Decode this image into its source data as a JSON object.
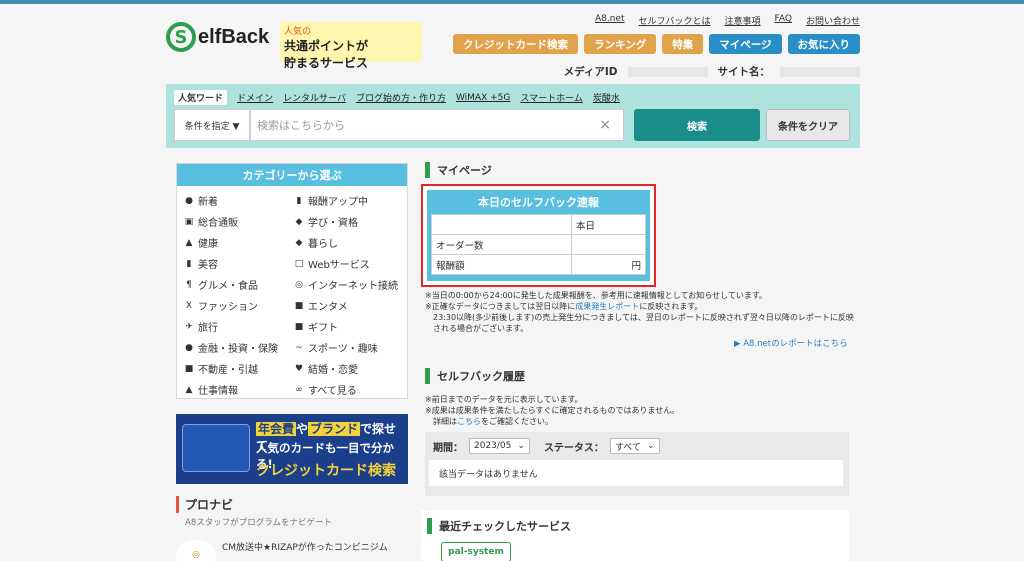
{
  "header": {
    "logo_text": "elfBack",
    "logo_mark": "S",
    "banner": {
      "line1": "人気の",
      "line2": "共通ポイントが",
      "line3": "貯まるサービス"
    },
    "top_links": [
      "A8.net",
      "セルフバックとは",
      "注意事項",
      "FAQ",
      "お問い合わせ"
    ],
    "nav_buttons": [
      {
        "label": "クレジットカード検索",
        "color": "orange"
      },
      {
        "label": "ランキング",
        "color": "orange"
      },
      {
        "label": "特集",
        "color": "orange"
      },
      {
        "label": "マイページ",
        "color": "blue"
      },
      {
        "label": "お気に入り",
        "color": "blue"
      }
    ],
    "media_id_label": "メディアID",
    "site_name_label": "サイト名："
  },
  "search": {
    "popular_tag": "人気ワード",
    "keywords": [
      "ドメイン",
      "レンタルサーバ",
      "ブログ始め方・作り方",
      "WiMAX +5G",
      "スマートホーム",
      "炭酸水"
    ],
    "condition_label": "条件を指定 ▼",
    "placeholder": "検索はこちらから",
    "clear_icon": "×",
    "search_button": "検索",
    "clear_button": "条件をクリア"
  },
  "category": {
    "title": "カテゴリーから選ぶ",
    "items": [
      {
        "icon": "●",
        "label": "新着"
      },
      {
        "icon": "▮",
        "label": "報酬アップ中"
      },
      {
        "icon": "▣",
        "label": "総合通販"
      },
      {
        "icon": "◆",
        "label": "学び・資格"
      },
      {
        "icon": "▲",
        "label": "健康"
      },
      {
        "icon": "◆",
        "label": "暮らし"
      },
      {
        "icon": "▮",
        "label": "美容"
      },
      {
        "icon": "□",
        "label": "Webサービス"
      },
      {
        "icon": "¶",
        "label": "グルメ・食品"
      },
      {
        "icon": "◎",
        "label": "インターネット接続"
      },
      {
        "icon": "X",
        "label": "ファッション"
      },
      {
        "icon": "■",
        "label": "エンタメ"
      },
      {
        "icon": "✈",
        "label": "旅行"
      },
      {
        "icon": "■",
        "label": "ギフト"
      },
      {
        "icon": "●",
        "label": "金融・投資・保険"
      },
      {
        "icon": "~",
        "label": "スポーツ・趣味"
      },
      {
        "icon": "■",
        "label": "不動産・引越"
      },
      {
        "icon": "♥",
        "label": "結婚・恋愛"
      },
      {
        "icon": "▲",
        "label": "仕事情報"
      },
      {
        "icon": "∞",
        "label": "すべて見る"
      }
    ]
  },
  "card_ad": {
    "line1_a": "年会費",
    "line1_b": "や",
    "line1_c": "ブランド",
    "line1_d": "で探せて",
    "line2": "人気のカードも一目で分かる!",
    "line3": "クレジットカード検索"
  },
  "pronavi": {
    "title": "プロナビ",
    "subtitle": "A8スタッフがプログラムをナビゲート",
    "item": "CM放送中★RIZAPが作ったコンビニジム"
  },
  "mypage": {
    "title": "マイページ",
    "report_title": "本日のセルフバック速報",
    "col_header": "本日",
    "rows": [
      {
        "label": "オーダー数",
        "value": ""
      },
      {
        "label": "報酬額",
        "value": "円"
      }
    ],
    "notes": [
      "※当日の0:00から24:00に発生した成果報酬を、参考用に速報情報としてお知らせしています。",
      "※正確なデータにつきましては翌日以降に",
      "成果発生レポート",
      "に反映されます。",
      "23:30以降(多少前後します)の売上発生分につきましては、翌日のレポートに反映されず翌々日以降のレポートに反映される場合がございます。"
    ],
    "a8_report_link": "▶ A8.netのレポートはこちら"
  },
  "history": {
    "title": "セルフバック履歴",
    "notes": [
      "※前日までのデータを元に表示しています。",
      "※成果は成果条件を満たしたらすぐに確定されるものではありません。",
      "詳細は",
      "こちら",
      "をご確認ください。"
    ],
    "period_label": "期間：",
    "period_value": "2023/05",
    "status_label": "ステータス：",
    "status_value": "すべて",
    "empty_text": "該当データはありません"
  },
  "recent": {
    "title": "最近チェックしたサービス",
    "item": "pal-system"
  }
}
